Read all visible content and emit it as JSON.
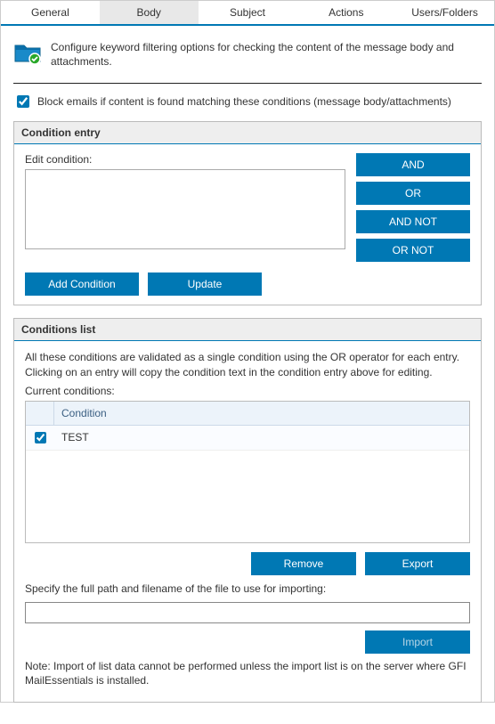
{
  "tabs": {
    "general": "General",
    "body": "Body",
    "subject": "Subject",
    "actions": "Actions",
    "users_folders": "Users/Folders"
  },
  "intro": "Configure keyword filtering options for checking the content of the message body and attachments.",
  "block_label": "Block emails if content is found matching these conditions (message body/attachments)",
  "condition_entry": {
    "header": "Condition entry",
    "edit_label": "Edit condition:",
    "textarea_value": "",
    "ops": {
      "and": "AND",
      "or": "OR",
      "and_not": "AND NOT",
      "or_not": "OR NOT"
    },
    "add_btn": "Add Condition",
    "update_btn": "Update"
  },
  "conditions_list": {
    "header": "Conditions list",
    "desc": "All these conditions are validated as a single condition using the OR operator for each entry. Clicking on an entry will copy the condition text in the condition entry above for editing.",
    "current_label": "Current conditions:",
    "col_condition": "Condition",
    "rows": [
      {
        "checked": true,
        "text": "TEST"
      }
    ],
    "remove_btn": "Remove",
    "export_btn": "Export",
    "path_label": "Specify the full path and filename of the file to use for importing:",
    "path_value": "",
    "import_btn": "Import",
    "note": "Note: Import of list data cannot be performed unless the import list is on the server where GFI MailEssentials is installed."
  }
}
